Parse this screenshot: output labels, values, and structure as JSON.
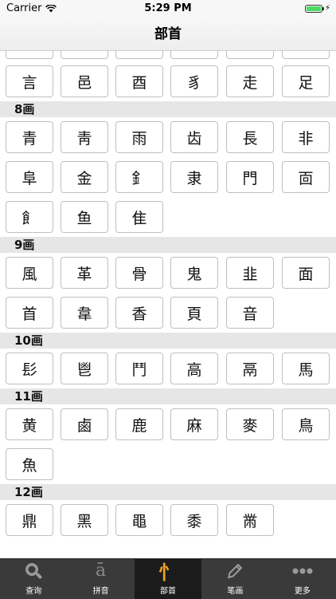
{
  "status": {
    "carrier": "Carrier",
    "time": "5:29 PM"
  },
  "nav": {
    "title": "部首"
  },
  "top_row": [
    "",
    "",
    "",
    "",
    "",
    ""
  ],
  "row_7b": [
    "言",
    "邑",
    "酉",
    "豸",
    "走",
    "足"
  ],
  "sections": [
    {
      "title": "8画",
      "rows": [
        [
          "青",
          "靑",
          "雨",
          "齿",
          "長",
          "非"
        ],
        [
          "阜",
          "金",
          "釒",
          "隶",
          "門",
          "靣"
        ],
        [
          "飠",
          "鱼",
          "隹"
        ]
      ]
    },
    {
      "title": "9画",
      "rows": [
        [
          "風",
          "革",
          "骨",
          "鬼",
          "韭",
          "面"
        ],
        [
          "首",
          "韋",
          "香",
          "頁",
          "音"
        ]
      ]
    },
    {
      "title": "10画",
      "rows": [
        [
          "髟",
          "鬯",
          "鬥",
          "高",
          "鬲",
          "馬"
        ]
      ]
    },
    {
      "title": "11画",
      "rows": [
        [
          "黄",
          "鹵",
          "鹿",
          "麻",
          "麥",
          "鳥"
        ],
        [
          "魚"
        ]
      ]
    },
    {
      "title": "12画",
      "rows": [
        [
          "鼎",
          "黑",
          "黽",
          "黍",
          "黹"
        ]
      ]
    }
  ],
  "tabs": [
    {
      "label": "查询",
      "icon": "search-icon"
    },
    {
      "label": "拼音",
      "icon": "pinyin-icon",
      "glyph": "ā"
    },
    {
      "label": "部首",
      "icon": "radical-icon",
      "glyph": "忄",
      "active": true
    },
    {
      "label": "笔画",
      "icon": "pencil-icon"
    },
    {
      "label": "更多",
      "icon": "more-icon"
    }
  ],
  "colors": {
    "tab_bar": "#3a3a3a",
    "active_tab": "#1b1b1b",
    "radical_icon": "#f0a020",
    "section_header": "#e6e6e6"
  }
}
